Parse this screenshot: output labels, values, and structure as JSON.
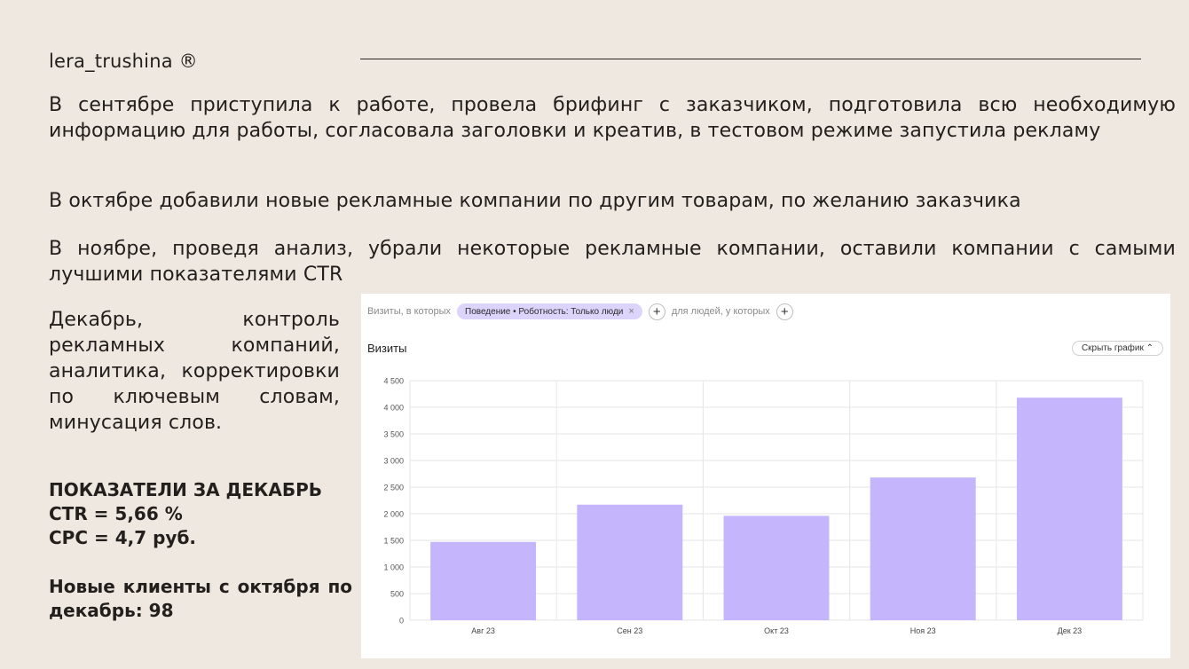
{
  "header": {
    "brand": "lera_trushina ®"
  },
  "paragraphs": {
    "september": "В сентябре приступила к работе, провела брифинг с заказчиком, подготовила всю необходимую информацию для работы, согласовала заголовки и креатив, в тестовом режиме запустила рекламу",
    "october": "В октябре добавили новые рекламные компании по другим товарам, по желанию заказчика",
    "november": "В ноябре, проведя анализ, убрали некоторые рекламные компании, оставили компании с самыми лучшими показателями CTR",
    "december": "Декабрь, контроль рекламных компаний, аналитика, корректировки по ключевым словам, минусация слов."
  },
  "metrics": {
    "heading": "ПОКАЗАТЕЛИ ЗА ДЕКАБРЬ",
    "ctr": "CTR = 5,66 %",
    "cpc": "CPC = 4,7 руб.",
    "clients": "Новые клиенты с октября по декабрь:  98"
  },
  "panel": {
    "filter_prefix": "Визиты, в которых",
    "chip_label": "Поведение • Роботность: Только люди",
    "chip_close": "×",
    "plus": "+",
    "filter_suffix": "для людей, у которых",
    "title": "Визиты",
    "hide_button": "Скрыть график",
    "chevron": "⌃"
  },
  "colors": {
    "bar": "#c4b5fd",
    "background": "#efe8e1",
    "grid": "#e6e6e6"
  },
  "chart_data": {
    "type": "bar",
    "title": "Визиты",
    "categories": [
      "Авг 23",
      "Сен 23",
      "Окт 23",
      "Ноя 23",
      "Дек 23"
    ],
    "values": [
      1470,
      2170,
      1960,
      2680,
      4180
    ],
    "yticks": [
      0,
      500,
      1000,
      1500,
      2000,
      2500,
      3000,
      3500,
      4000,
      4500
    ],
    "ytick_labels": [
      "0",
      "500",
      "1 000",
      "1 500",
      "2 000",
      "2 500",
      "3 000",
      "3 500",
      "4 000",
      "4 500"
    ],
    "ylim": [
      0,
      4500
    ],
    "grid": true
  }
}
